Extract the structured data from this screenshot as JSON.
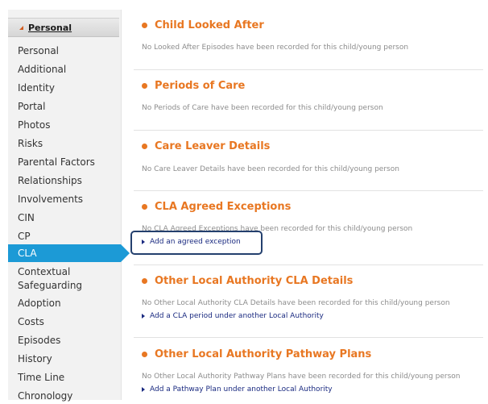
{
  "sidebar": {
    "header": "Personal",
    "items": [
      {
        "label": "Personal"
      },
      {
        "label": "Additional"
      },
      {
        "label": "Identity"
      },
      {
        "label": "Portal"
      },
      {
        "label": "Photos"
      },
      {
        "label": "Risks"
      },
      {
        "label": "Parental Factors"
      },
      {
        "label": "Relationships"
      },
      {
        "label": "Involvements"
      },
      {
        "label": "CIN"
      },
      {
        "label": "CP"
      },
      {
        "label": "CLA"
      },
      {
        "label": "Contextual"
      },
      {
        "label": "Safeguarding"
      },
      {
        "label": "Adoption"
      },
      {
        "label": "Costs"
      },
      {
        "label": "Episodes"
      },
      {
        "label": "History"
      },
      {
        "label": "Time Line"
      },
      {
        "label": "Chronology"
      }
    ]
  },
  "colors": {
    "accent": "#e87722",
    "active_nav": "#1c9ad6",
    "link": "#1a2a80",
    "highlight_border": "#24406e"
  },
  "sections": [
    {
      "title": "Child Looked After",
      "message": "No Looked After Episodes have been recorded for this child/young person"
    },
    {
      "title": "Periods of Care",
      "message": "No Periods of Care have been recorded for this child/young person"
    },
    {
      "title": "Care Leaver Details",
      "message": "No Care Leaver Details have been recorded for this child/young person"
    },
    {
      "title": "CLA Agreed Exceptions",
      "message": "No CLA Agreed Exceptions have been recorded for this child/young person",
      "link": "Add an agreed exception"
    },
    {
      "title": "Other Local Authority CLA Details",
      "message": "No Other Local Authority CLA Details have been recorded for this child/young person",
      "link": "Add a CLA period under another Local Authority"
    },
    {
      "title": "Other Local Authority Pathway Plans",
      "message": "No Other Local Authority Pathway Plans have been recorded for this child/young person",
      "link": "Add a Pathway Plan under another Local Authority"
    }
  ]
}
